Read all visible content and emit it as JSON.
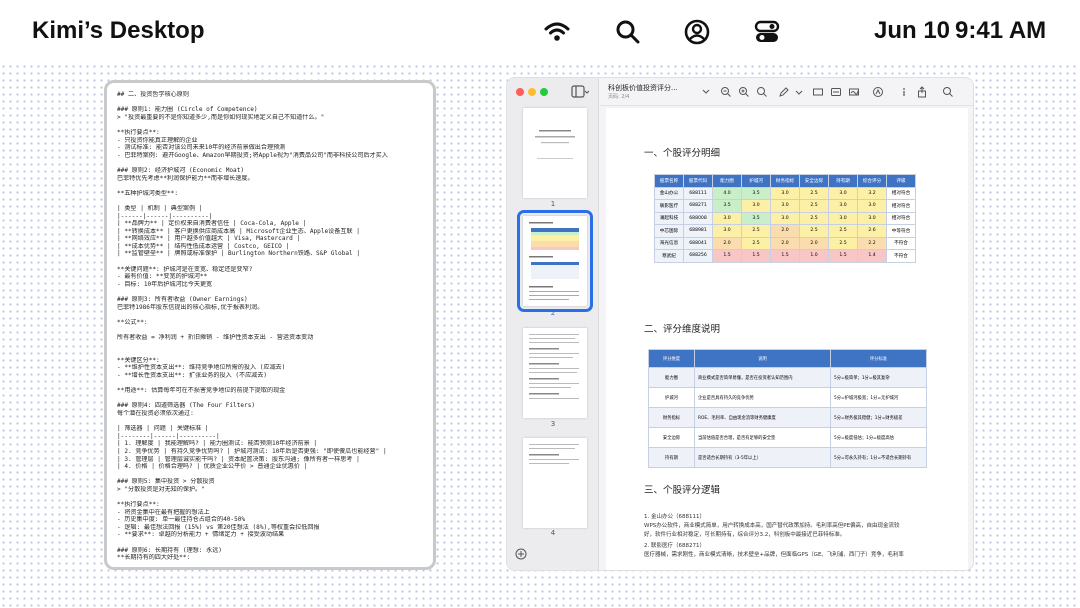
{
  "menubar": {
    "title": "Kimi’s Desktop",
    "date": "Jun 10",
    "time": "9:41 AM",
    "icons": [
      "wifi-icon",
      "search-icon",
      "user-icon",
      "control-center-icon"
    ]
  },
  "editor": {
    "lines": [
      "## 二、投资哲学核心原则",
      "",
      "### 原则1: 能力圈 (Circle of Competence)",
      "> \"投资最重要的不是你知道多少,而是你如何现实地定义自己不知道什么。\"",
      "",
      "**执行要点**:",
      "- 只投资你能真正理解的企业",
      "- 测试标准: 能否对该公司未来10年的经济前景做出合理预测",
      "- 巴菲特案例: 避开Google、Amazon早期投资;将Apple视为\"消费品公司\"而非科技公司后才买入",
      "",
      "### 原则2: 经济护城河 (Economic Moat)",
      "巴菲特优先考虑**利润保护能力**而非增长速度。",
      "",
      "**五种护城河类型**:",
      "",
      "| 类型 | 机制 | 典型案例 |",
      "|------|------|----------|",
      "| **品牌力** | 定价权来自消费者信任 | Coca-Cola, Apple |",
      "| **转换成本** | 客户更换供应商成本高 | Microsoft企业生态、Apple设备互联 |",
      "| **网络效应** | 用户越多价值越大 | Visa, Mastercard |",
      "| **成本优势** | 结构性低成本运营 | Costco, GEICO |",
      "| **监管壁垒** | 牌照或标准保护 | Burlington Northern铁路、S&P Global |",
      "",
      "**关键问题**: 护城河是在变宽、稳定还是变窄?",
      "- 最有价值: **变宽的护城河**",
      "- 目标: 10年后护城河比今天更宽",
      "",
      "### 原则3: 所有者收益 (Owner Earnings)",
      "巴菲特1986年股东信提出的核心指标,优于报表利润。",
      "",
      "**公式**:",
      "",
      "所有者收益 = 净利润 + 折旧摊销 - 维护性资本支出 - 营运资本变动",
      "",
      "",
      "**关键区分**:",
      "- **维护性资本支出**: 维持竞争地位所需的投入 (应减去)",
      "- **增长性资本支出**: 扩张业务的投入 (不应减去)",
      "",
      "**用途**: 估算每年可在不损害竞争地位的前提下提取的现金",
      "",
      "### 原则4: 四道筛选器 (The Four Filters)",
      "每个潜在投资必须依次通过:",
      "",
      "| 筛选器 | 问题 | 关键标准 |",
      "|--------|------|----------|",
      "| 1. 理解度 | 我能理解吗? | 能力圈测试: 能否预测10年经济前景 |",
      "| 2. 竞争优势 | 有持久竞争优势吗? | 护城河测试: 10年后是否更强: \"即使傻瓜也能经营\" |",
      "| 3. 管理层 | 管理层诚实能干吗? | 资本配置决策: 股东沟通; 像所有者一样思考 |",
      "| 4. 价格 | 价格合理吗? | 优质企业公平价 > 普通企业优惠价 |",
      "",
      "### 原则5: 集中投资 > 分散投资",
      "> \"分散投资是对无知的保护。\"",
      "",
      "**执行要点**:",
      "- 将资金集中在最有把握的想法上",
      "- 历史集中度: 单一最佳持仓占组合的40-50%",
      "- 逻辑: 最佳想法回报 (15%) vs 第20佳想法 (8%),等权重会拉低回报",
      "- **要求**: 卓越的分析能力 + 情绪定力 + 接受波动结果",
      "",
      "### 原则6: 长期持有 (理想: 永远)",
      "**长期持有的四大好处**:"
    ]
  },
  "preview": {
    "doc_title": "科创板价值投资评分...",
    "doc_subtitle": "页码: 2/4",
    "thumbnails": [
      "1",
      "2",
      "3",
      "4"
    ],
    "selected_page": "2",
    "page": {
      "section1": "一、个股评分明细",
      "table1": {
        "headers": [
          "股票名称",
          "股票代码",
          "能力圈",
          "护城河",
          "财务指标",
          "安全边际",
          "持有期",
          "综合评分",
          "评级"
        ],
        "rows": [
          [
            "金山办公",
            "688111",
            "4.0",
            "3.5",
            "3.0",
            "2.5",
            "3.0",
            "3.2",
            "相对符合"
          ],
          [
            "联影医疗",
            "688271",
            "3.5",
            "3.0",
            "3.0",
            "2.5",
            "3.0",
            "3.0",
            "相对符合"
          ],
          [
            "澜起科技",
            "688008",
            "3.0",
            "3.5",
            "3.0",
            "2.5",
            "3.0",
            "3.0",
            "相对符合"
          ],
          [
            "中芯国际",
            "688981",
            "3.0",
            "2.5",
            "2.0",
            "2.5",
            "2.5",
            "2.6",
            "中等符合"
          ],
          [
            "海光信息",
            "688041",
            "2.0",
            "2.5",
            "2.0",
            "2.0",
            "2.5",
            "2.2",
            "不符合"
          ],
          [
            "寒武纪",
            "688256",
            "1.5",
            "1.5",
            "1.5",
            "1.0",
            "1.5",
            "1.4",
            "不符合"
          ]
        ]
      },
      "section2": "二、评分维度说明",
      "table2": {
        "headers": [
          "评分维度",
          "说明",
          "评分标准"
        ],
        "rows": [
          [
            "能力圈",
            "商业模式是否简单易懂，是否在投资者认知范围内",
            "5分=极简单；1分=极其复杂"
          ],
          [
            "护城河",
            "企业是否具有持久的竞争优势",
            "5分=护城河极宽；1分=无护城河"
          ],
          [
            "财务指标",
            "ROE、毛利率、自由现金流等财务健康度",
            "5分=财务极其稳健；1分=财务极差"
          ],
          [
            "安全边际",
            "当前估值是否合理，是否有足够的安全垫",
            "5分=极度低估；1分=极度高估"
          ],
          [
            "持有期",
            "是否适合长期持有（3-5年以上）",
            "5分=可永久持有；1分=不适合长期持有"
          ]
        ]
      },
      "section3": "三、个股评分逻辑",
      "logic": [
        "1. 金山办公（688111）",
        "WPS办公软件，商业模式简单，用户转换成本高，国产替代政策加持。毛利率高但PE偏高，自由现金流较",
        "好，软件行业相对稳定，可长期持有，综合评分3.2，科创板中最接近巴菲特标准。",
        "2. 联影医疗（688271）",
        "医疗器械，需求刚性，商业模式清晰，技术壁垒+品牌，但面临GPS（GE、飞利浦、西门子）竞争，毛利率"
      ]
    }
  },
  "colors": {
    "header_blue": "#3f73c4",
    "green": "#c9efc9",
    "yellow": "#fbf0a6",
    "orange": "#fbdcae",
    "red": "#f9c6c6",
    "selection_blue": "#2a6fe8"
  }
}
